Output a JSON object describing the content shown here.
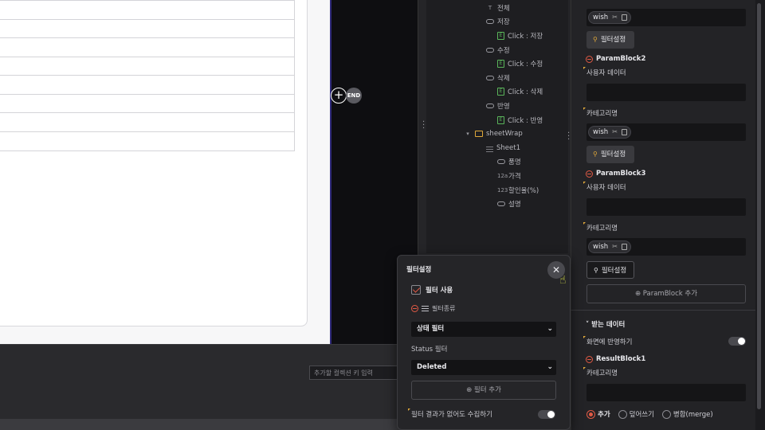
{
  "canvas": {
    "grid_rows": 8,
    "end_label": "END",
    "add_node_label": "+",
    "key_input_placeholder": "추가할 컬렉션 키 입력"
  },
  "tree": {
    "items": [
      {
        "label": "전체",
        "icon": "text-icon"
      },
      {
        "label": "저장",
        "icon": "link-icon"
      },
      {
        "label": "Click : 저장",
        "icon": "event-icon"
      },
      {
        "label": "수정",
        "icon": "link-icon"
      },
      {
        "label": "Click : 수정",
        "icon": "event-icon"
      },
      {
        "label": "삭제",
        "icon": "link-icon"
      },
      {
        "label": "Click : 삭제",
        "icon": "event-icon"
      },
      {
        "label": "반영",
        "icon": "link-icon"
      },
      {
        "label": "Click : 반영",
        "icon": "event-icon"
      },
      {
        "label": "sheetWrap",
        "icon": "folder-icon"
      },
      {
        "label": "Sheet1",
        "icon": "sheet-icon"
      },
      {
        "label": "품명",
        "icon": "text-field-icon"
      },
      {
        "label": "가격",
        "icon": "number-field-icon"
      },
      {
        "label": "할인율(%)",
        "icon": "number-field-icon"
      },
      {
        "label": "설명",
        "icon": "text-field-icon"
      }
    ],
    "event_badge": "E",
    "number_badge": "12a",
    "percent_badge": "123"
  },
  "props": {
    "wish_chip": "wish",
    "filter_button": "필터설정",
    "blocks": [
      {
        "title": "ParamBlock2",
        "user_data_label": "사용자 데이터",
        "category_label": "카테고리명"
      },
      {
        "title": "ParamBlock3",
        "user_data_label": "사용자 데이터",
        "category_label": "카테고리명"
      }
    ],
    "add_param_block": "ParamBlock 추가",
    "receive_section": "받는 데이터",
    "reflect_label": "화면에 반영하기",
    "result_block": "ResultBlock1",
    "result_category_label": "카테고리명",
    "radio_options": [
      "추가",
      "덮어쓰기",
      "병합(merge)"
    ],
    "radio_selected": "추가"
  },
  "popup": {
    "title": "필터설정",
    "use_filter_label": "필터 사용",
    "use_filter_checked": true,
    "filter_type_label": "필터종류",
    "filter_type_value": "상태 필터",
    "status_label": "Status 필터",
    "status_value": "Deleted",
    "add_filter": "필터 추가",
    "collect_empty_label": "필터 결과가 없어도 수집하기",
    "collect_empty_on": false
  },
  "colors": {
    "accent": "#e25a45",
    "warning": "#e0a83a",
    "event": "#5ab55a"
  }
}
